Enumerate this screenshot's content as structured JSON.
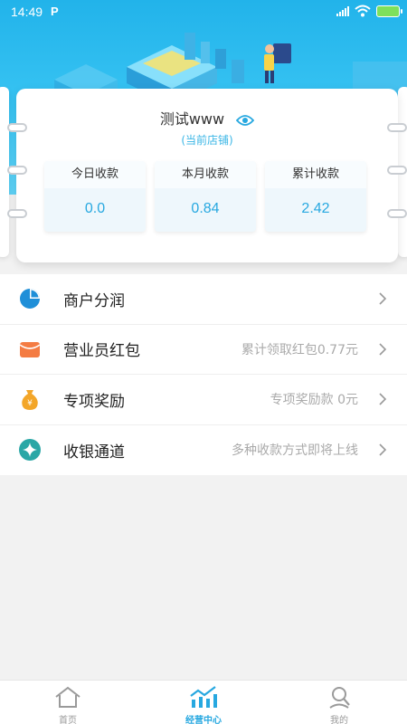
{
  "status_bar": {
    "time": "14:49",
    "app_badge": "P"
  },
  "store": {
    "name": "测试www",
    "subtitle": "(当前店铺)",
    "stats": [
      {
        "label": "今日收款",
        "value": "0.0"
      },
      {
        "label": "本月收款",
        "value": "0.84"
      },
      {
        "label": "累计收款",
        "value": "2.42"
      }
    ]
  },
  "menu": [
    {
      "label": "商户分润",
      "detail": "",
      "icon": "pie-chart-icon",
      "color": "#1f8fd8"
    },
    {
      "label": "营业员红包",
      "detail": "累计领取红包0.77元",
      "icon": "red-packet-icon",
      "color": "#f47c43"
    },
    {
      "label": "专项奖励",
      "detail": "专项奖励款  0元",
      "icon": "money-bag-icon",
      "color": "#f3a629"
    },
    {
      "label": "收银通道",
      "detail": "多种收款方式即将上线",
      "icon": "sparkle-icon",
      "color": "#2aa7a6"
    }
  ],
  "tabbar": {
    "tabs": [
      {
        "label": "首页",
        "icon": "home-icon",
        "active": false
      },
      {
        "label": "经营中心",
        "icon": "chart-icon",
        "active": true
      },
      {
        "label": "我的",
        "icon": "user-icon",
        "active": false
      }
    ]
  },
  "colors": {
    "accent": "#27a8e0",
    "header": "#22b3ea"
  }
}
